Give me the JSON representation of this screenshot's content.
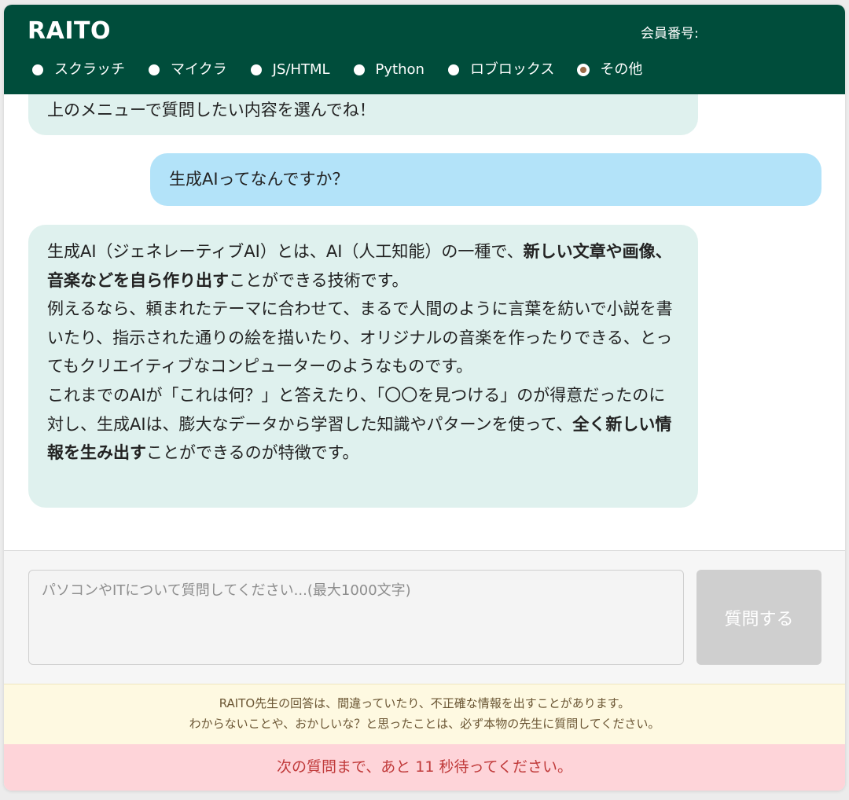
{
  "header": {
    "logo": "RAITO",
    "member_label": "会員番号:",
    "categories": [
      {
        "label": "スクラッチ",
        "checked": false
      },
      {
        "label": "マイクラ",
        "checked": false
      },
      {
        "label": "JS/HTML",
        "checked": false
      },
      {
        "label": "Python",
        "checked": false
      },
      {
        "label": "ロブロックス",
        "checked": false
      },
      {
        "label": "その他",
        "checked": true
      }
    ]
  },
  "chat": {
    "greeting": "上のメニューで質問したい内容を選んでね！",
    "user_question": "生成AIってなんですか？",
    "answer": {
      "p1_a": "生成AI（ジェネレーティブAI）とは、AI（人工知能）の一種で、",
      "p1_b": "新しい文章や画像、音楽などを自ら作り出す",
      "p1_c": "ことができる技術です。",
      "p2": "例えるなら、頼まれたテーマに合わせて、まるで人間のように言葉を紡いで小説を書いたり、指示された通りの絵を描いたり、オリジナルの音楽を作ったりできる、とってもクリエイティブなコンピューターのようなものです。",
      "p3_a": "これまでのAIが「これは何？」と答えたり、「〇〇を見つける」のが得意だったのに対し、生成AIは、膨大なデータから学習した知識やパターンを使って、",
      "p3_b": "全く新しい情報を生み出す",
      "p3_c": "ことができるのが特徴です。"
    }
  },
  "input": {
    "placeholder": "パソコンやITについて質問してください...(最大1000文字)",
    "value": "",
    "send_label": "質問する"
  },
  "disclaimer": {
    "line1": "RAITO先生の回答は、間違っていたり、不正確な情報を出すことがあります。",
    "line2": "わからないことや、おかしいな？と思ったことは、必ず本物の先生に質問してください。"
  },
  "notice": {
    "wait": "次の質問まで、あと 11 秒待ってください。"
  },
  "colors": {
    "header_bg": "#004d3b",
    "bot_bubble": "#dff1ee",
    "user_bubble": "#b3e3f9",
    "disclaimer_bg": "#fef9e1",
    "wait_bg": "#fed4d9",
    "wait_text": "#c03a3a"
  }
}
